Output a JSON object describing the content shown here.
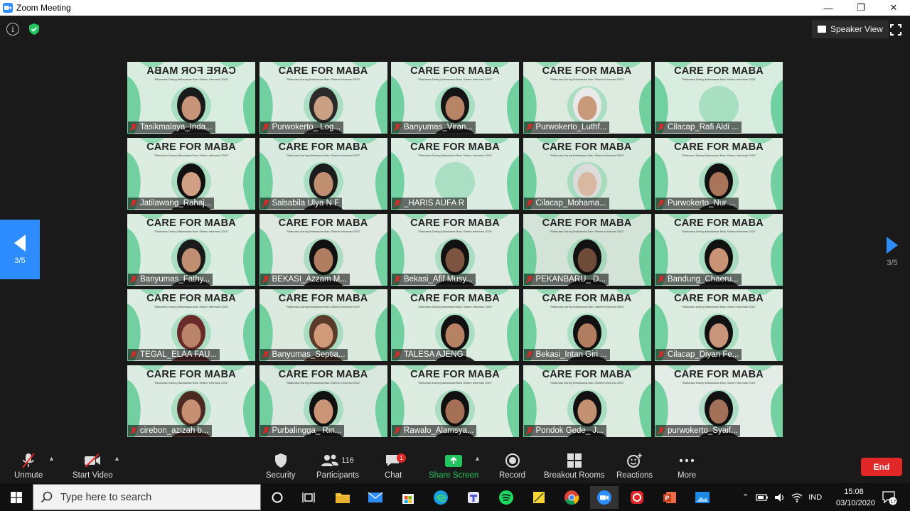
{
  "window": {
    "title": "Zoom Meeting",
    "minimize": "—",
    "restore": "❐",
    "close": "✕"
  },
  "meeting": {
    "info_symbol": "i",
    "view_button": "Speaker View",
    "page_left": "3/5",
    "page_right": "3/5"
  },
  "tile_banner": "CARE FOR MABA",
  "tile_subtitle": "\"Silaturasa Daring Mahasiswa Baru Sistem Informasi 2020\"",
  "participants": [
    {
      "name": "Tasikmalaya_Inda...",
      "bg": "#d9ece0",
      "hair": "#1a1a1a",
      "skin": "#c79479"
    },
    {
      "name": "Purwokerto_ Log...",
      "bg": "#dcece2",
      "hair": "#2a2a2a",
      "skin": "#caa084"
    },
    {
      "name": "Banyumas_Viran...",
      "bg": "#dbebe1",
      "hair": "#151515",
      "skin": "#b88466"
    },
    {
      "name": "Purwokerto_Luthf...",
      "bg": "#dceae0",
      "hair": "#e9e9e9",
      "skin": "#c89a7b"
    },
    {
      "name": "Cilacap_Rafi Aldi ...",
      "bg": "#d8ecdf",
      "hair": "",
      "skin": ""
    },
    {
      "name": "Jatilawang_Rahaj...",
      "bg": "#dcece1",
      "hair": "#111111",
      "skin": "#d1a084"
    },
    {
      "name": "Salsabila Ulya N F",
      "bg": "#d9ebe0",
      "hair": "#1c1c1c",
      "skin": "#c08e71"
    },
    {
      "name": "_HARIS AUFA R",
      "bg": "#dbede2",
      "hair": "",
      "skin": ""
    },
    {
      "name": "Cilacap_Mohama...",
      "bg": "#d7e8dc",
      "hair": "#dbdbdb",
      "skin": "#d8b8a0"
    },
    {
      "name": "Purwokerto_Nur ...",
      "bg": "#dcece1",
      "hair": "#111111",
      "skin": "#a9745a"
    },
    {
      "name": "Banyumas_Fathy...",
      "bg": "#dbece1",
      "hair": "#1a1a1a",
      "skin": "#c08f72"
    },
    {
      "name": "BEKASI_Azzam M...",
      "bg": "#dfe9e2",
      "hair": "#111111",
      "skin": "#b07d60"
    },
    {
      "name": "Bekasi_Afif Musy...",
      "bg": "#dceae1",
      "hair": "#111111",
      "skin": "#7d5440"
    },
    {
      "name": "PEKANBARU_ D...",
      "bg": "#d4e3d8",
      "hair": "#111111",
      "skin": "#6e4a38"
    },
    {
      "name": "Bandung_Chaeru...",
      "bg": "#d8e9de",
      "hair": "#111111",
      "skin": "#c99476"
    },
    {
      "name": "TEGAL_ELAA FAU...",
      "bg": "#dcece2",
      "hair": "#6a2a2a",
      "skin": "#b9846a"
    },
    {
      "name": "Banyumas_Septia...",
      "bg": "#dbe9df",
      "hair": "#5a3a28",
      "skin": "#d19b7a"
    },
    {
      "name": "TALESA AJENG",
      "bg": "#dcece1",
      "hair": "#111111",
      "skin": "#b78264"
    },
    {
      "name": "Bekasi_Intan Giri ...",
      "bg": "#dbebe0",
      "hair": "#111111",
      "skin": "#b17c5f"
    },
    {
      "name": "Cilacap_Diyan Fe...",
      "bg": "#dcece1",
      "hair": "#111111",
      "skin": "#c8957a"
    },
    {
      "name": "cirebon_azizah b...",
      "bg": "#dcece2",
      "hair": "#4a2a22",
      "skin": "#c89072"
    },
    {
      "name": "Purbalingga_ Rin...",
      "bg": "#d9e8de",
      "hair": "#111111",
      "skin": "#c99576"
    },
    {
      "name": "Rawalo_Alamsya...",
      "bg": "#dcece1",
      "hair": "#111111",
      "skin": "#a57055"
    },
    {
      "name": "Pondok Gede_ J...",
      "bg": "#dbebe0",
      "hair": "#111111",
      "skin": "#c49072"
    },
    {
      "name": "purwokerto_Syaif...",
      "bg": "#e4ece7",
      "hair": "#111111",
      "skin": "#a27158"
    }
  ],
  "toolbar": {
    "unmute": "Unmute",
    "start_video": "Start Video",
    "security": "Security",
    "participants": "Participants",
    "participants_count": "116",
    "chat": "Chat",
    "chat_badge": "1",
    "share_screen": "Share Screen",
    "record": "Record",
    "breakout_rooms": "Breakout Rooms",
    "reactions": "Reactions",
    "more": "More",
    "end": "End"
  },
  "taskbar": {
    "search_placeholder": "Type here to search",
    "language": "IND",
    "time": "15:08",
    "date": "03/10/2020",
    "notifications": "17"
  },
  "colors": {
    "zoom_blue": "#2d8cff",
    "end_red": "#e02828",
    "share_green": "#22c55e",
    "leaf_green": "#4fc78a"
  }
}
